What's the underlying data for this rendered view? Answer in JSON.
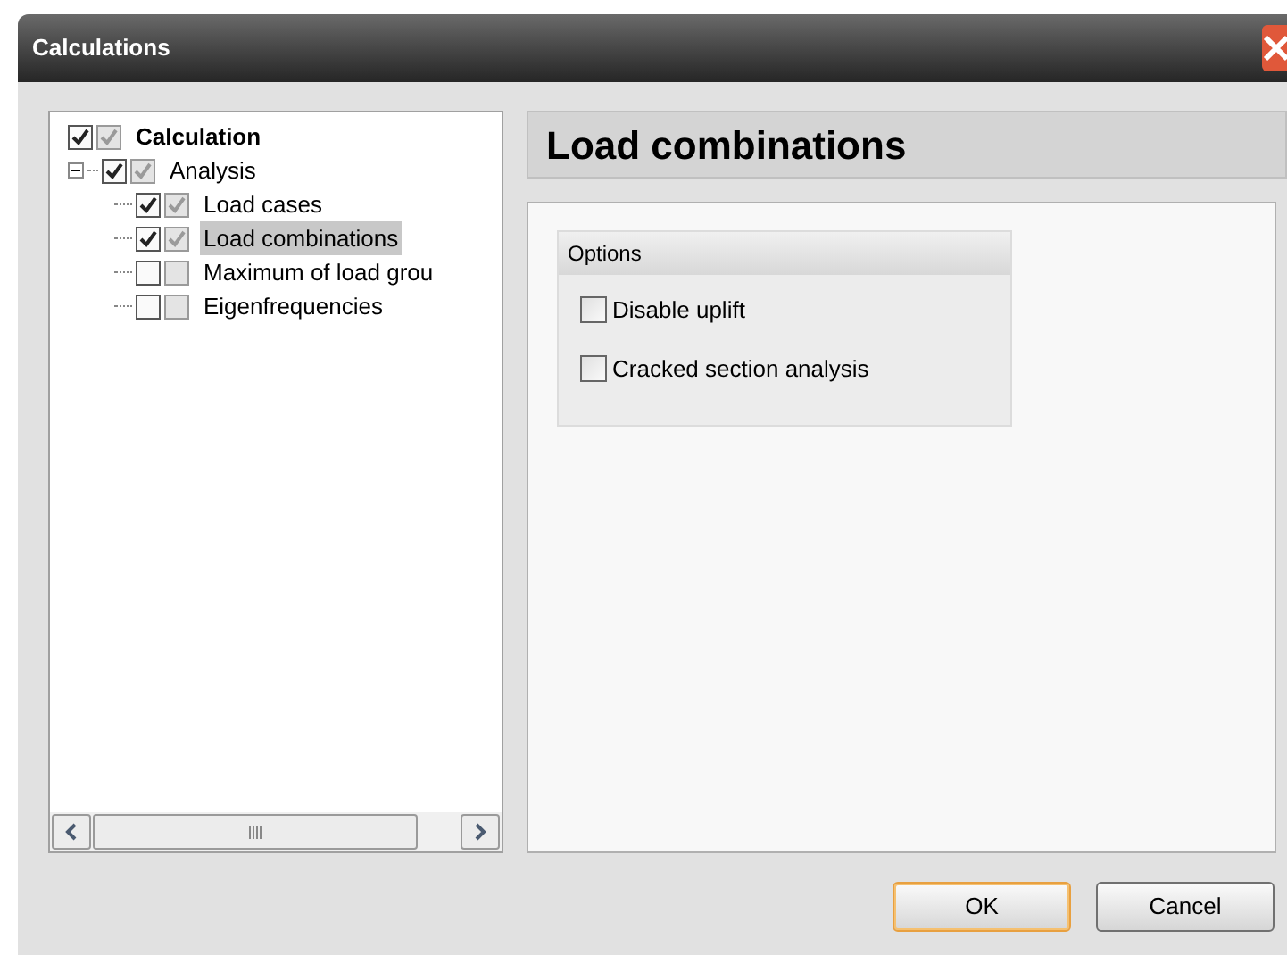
{
  "window": {
    "title": "Calculations"
  },
  "tree": [
    {
      "kind": "root",
      "label": "Calculation",
      "checked": true,
      "grey_checked": true,
      "selected": false
    },
    {
      "kind": "group",
      "label": "Analysis",
      "checked": true,
      "grey_checked": true,
      "selected": false,
      "expanded": true,
      "children": [
        {
          "label": "Load cases",
          "checked": true,
          "grey_checked": true,
          "selected": false
        },
        {
          "label": "Load combinations",
          "checked": true,
          "grey_checked": true,
          "selected": true
        },
        {
          "label": "Maximum of load grou",
          "checked": false,
          "grey_checked": false,
          "selected": false
        },
        {
          "label": "Eigenfrequencies",
          "checked": false,
          "grey_checked": false,
          "selected": false
        }
      ]
    }
  ],
  "panel": {
    "title": "Load combinations",
    "group": {
      "title": "Options",
      "options": [
        {
          "label": "Disable uplift",
          "checked": false
        },
        {
          "label": "Cracked section analysis",
          "checked": false
        }
      ]
    }
  },
  "buttons": [
    {
      "label": "OK",
      "default": true
    },
    {
      "label": "Cancel",
      "default": false
    }
  ]
}
